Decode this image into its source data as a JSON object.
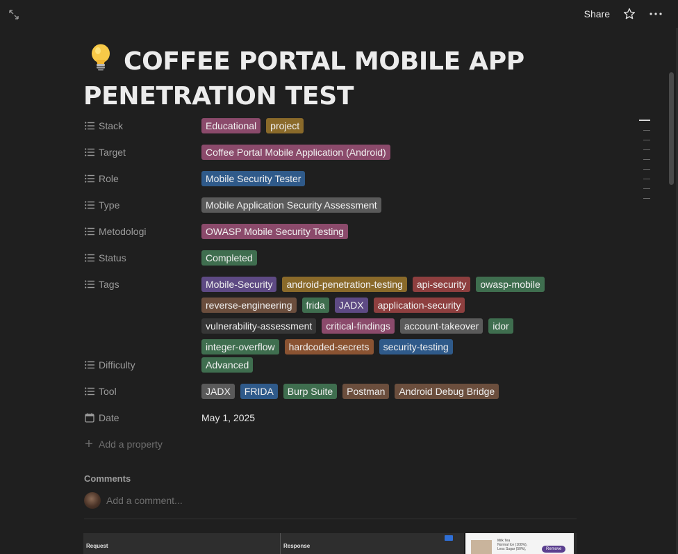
{
  "topbar": {
    "share_label": "Share"
  },
  "page": {
    "title": "COFFEE PORTAL MOBILE APP PENETRATION TEST",
    "icon": "lightbulb-emoji"
  },
  "properties": [
    {
      "label": "Stack",
      "icon": "list-icon",
      "tags": [
        {
          "text": "Educational",
          "color": "#8b4a6b"
        },
        {
          "text": "project",
          "color": "#8a6a2a"
        }
      ]
    },
    {
      "label": "Target",
      "icon": "list-icon",
      "tags": [
        {
          "text": "Coffee Portal Mobile Application (Android)",
          "color": "#8b4a6b"
        }
      ]
    },
    {
      "label": "Role",
      "icon": "list-icon",
      "tags": [
        {
          "text": "Mobile Security Tester",
          "color": "#2f5a8a"
        }
      ]
    },
    {
      "label": "Type",
      "icon": "list-icon",
      "tags": [
        {
          "text": "Mobile Application Security Assessment",
          "color": "#5a5a5a"
        }
      ]
    },
    {
      "label": "Metodologi",
      "icon": "list-icon",
      "tags": [
        {
          "text": "OWASP Mobile Security Testing",
          "color": "#8b4a6b"
        }
      ]
    },
    {
      "label": "Status",
      "icon": "list-icon",
      "tags": [
        {
          "text": "Completed",
          "color": "#3f6e4f"
        }
      ]
    },
    {
      "label": "Tags",
      "icon": "list-icon",
      "tags": [
        {
          "text": "Mobile-Security",
          "color": "#5e4a84"
        },
        {
          "text": "android-penetration-testing",
          "color": "#8a6a2a"
        },
        {
          "text": "api-security",
          "color": "#8e3f3f"
        },
        {
          "text": "owasp-mobile",
          "color": "#3f6e4f"
        },
        {
          "text": "reverse-engineering",
          "color": "#6b4e3d"
        },
        {
          "text": "frida",
          "color": "#3f6e4f"
        },
        {
          "text": "JADX",
          "color": "#5e4a84"
        },
        {
          "text": "application-security",
          "color": "#8e3f3f"
        },
        {
          "text": "vulnerability-assessment",
          "color": "#363636"
        },
        {
          "text": "critical-findings",
          "color": "#8b4a6b"
        },
        {
          "text": "account-takeover",
          "color": "#5a5a5a"
        },
        {
          "text": "idor",
          "color": "#3f6e4f"
        },
        {
          "text": "integer-overflow",
          "color": "#3f6e4f"
        },
        {
          "text": "hardcoded-secrets",
          "color": "#8a5332"
        },
        {
          "text": "security-testing",
          "color": "#2f5a8a"
        }
      ]
    },
    {
      "label": "Difficulty",
      "icon": "list-icon",
      "tags": [
        {
          "text": "Advanced",
          "color": "#3f6e4f"
        }
      ]
    },
    {
      "label": "Tool",
      "icon": "list-icon",
      "tags": [
        {
          "text": "JADX",
          "color": "#5a5a5a"
        },
        {
          "text": "FRIDA",
          "color": "#2f5a8a"
        },
        {
          "text": "Burp Suite",
          "color": "#3f6e4f"
        },
        {
          "text": "Postman",
          "color": "#6b4e3d"
        },
        {
          "text": "Android Debug Bridge",
          "color": "#6b4e3d"
        }
      ]
    }
  ],
  "date_property": {
    "label": "Date",
    "icon": "calendar-icon",
    "value": "May 1, 2025"
  },
  "add_property_label": "Add a property",
  "comments": {
    "heading": "Comments",
    "placeholder": "Add a comment..."
  },
  "preview": {
    "request_label": "Request",
    "response_label": "Response",
    "phone_text_1": "Milk Tea",
    "phone_text_2": "Normal Ice (100%),",
    "phone_text_3": "Less Sugar (50%),",
    "phone_button": "Remove"
  }
}
